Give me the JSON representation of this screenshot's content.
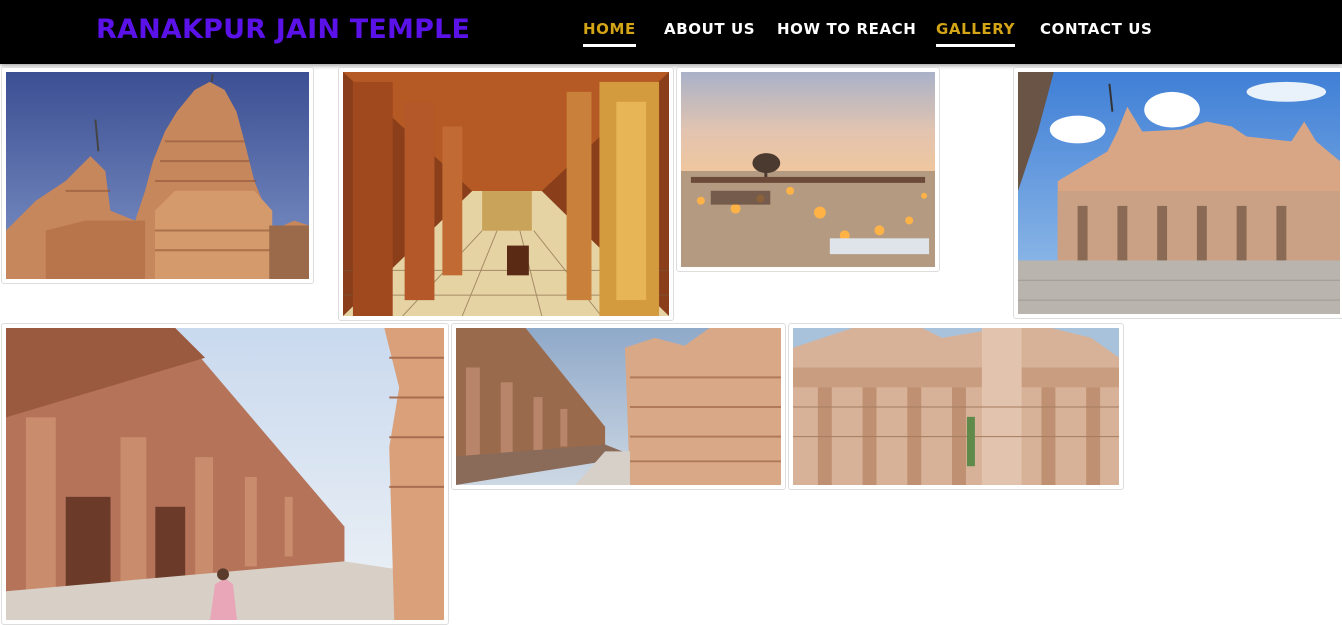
{
  "header": {
    "brand": "RANAKPUR JAIN TEMPLE",
    "brand_color": "#5a12e8",
    "nav": [
      {
        "label": "HOME",
        "active": true
      },
      {
        "label": "ABOUT US",
        "active": false
      },
      {
        "label": "HOW TO REACH",
        "active": false
      },
      {
        "label": "GALLERY",
        "active": true
      },
      {
        "label": "CONTACT US",
        "active": false
      }
    ],
    "active_color": "#d4a516"
  },
  "gallery": {
    "images": [
      {
        "subject": "temple-shikhara-exterior"
      },
      {
        "subject": "pillared-corridor-interior"
      },
      {
        "subject": "desert-camp-at-dusk"
      },
      {
        "subject": "temple-courtyard-exterior"
      },
      {
        "subject": "carved-colonnade-corridor"
      },
      {
        "subject": "temple-side-corridor"
      },
      {
        "subject": "carved-temple-pavilion"
      }
    ]
  }
}
